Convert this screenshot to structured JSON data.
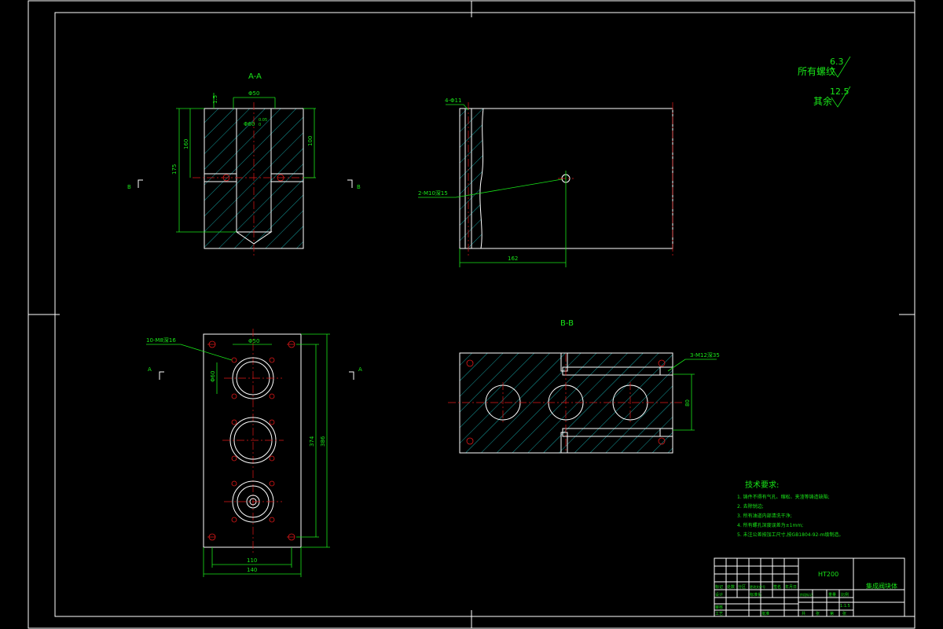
{
  "views": {
    "section_aa": {
      "title": "A-A",
      "dims": [
        "Φ50",
        "1.5",
        "Φ60",
        "0.05",
        "0",
        "175",
        "160",
        "100"
      ],
      "marks": [
        "B",
        "B"
      ]
    },
    "side_view": {
      "dims": [
        "4-Φ11",
        "2-M10深15",
        "162"
      ]
    },
    "plan_view": {
      "dims": [
        "10-M8深16",
        "Φ50",
        "Φ60",
        "110",
        "140",
        "374",
        "386"
      ],
      "marks": [
        "A",
        "A"
      ]
    },
    "section_bb": {
      "title": "B-B",
      "dims": [
        "3-M12深35",
        "80"
      ]
    }
  },
  "roughness": {
    "label1": "所有螺纹",
    "value1": "6.3",
    "label2": "其余",
    "value2": "12.5"
  },
  "tech_req": {
    "title": "技术要求:",
    "items": [
      "1. 铸件不得有气孔、缩松、夹渣等铸造缺陷;",
      "2. 去除锐边;",
      "3. 所有油道内部清洗干净;",
      "4. 所有螺孔深度误差为±1mm;",
      "5. 未注公差按加工尺寸,按GB1804-92-m级制造。"
    ]
  },
  "title_block": {
    "material": "HT200",
    "part_name": "集成阀块体",
    "scale": "1:1.5",
    "cells": [
      "标记",
      "处数",
      "分区",
      "更改文件号",
      "签名",
      "年月日",
      "设计",
      "标准化",
      "审核",
      "工艺",
      "批准",
      "阶段标记",
      "重量",
      "比例",
      "共",
      "张",
      "第",
      "张"
    ]
  }
}
